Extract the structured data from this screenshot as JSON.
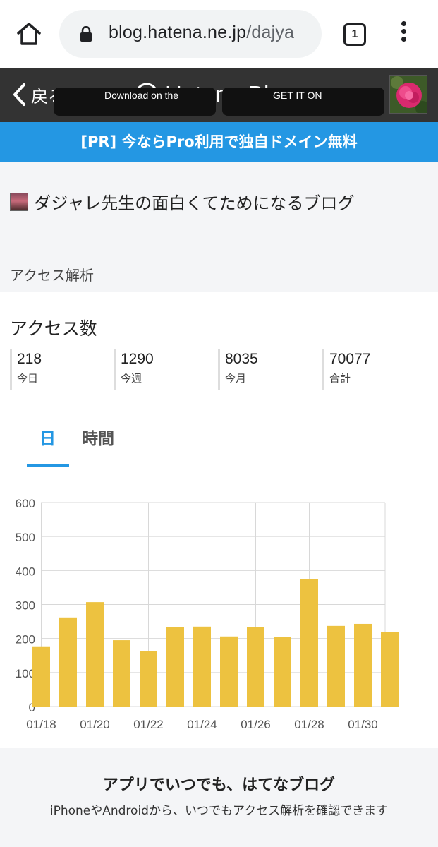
{
  "browser": {
    "url_main": "blog.hatena.ne.jp",
    "url_rest": "/dajya",
    "tab_count": "1",
    "icons": [
      "home-icon",
      "lock-icon",
      "tab-switcher-icon",
      "more-vert-icon"
    ]
  },
  "header": {
    "back_label": "戻る",
    "logo_text": "Hatena Blog",
    "icons": [
      "back-chevron-icon",
      "hatena-pen-icon",
      "flower-avatar"
    ]
  },
  "promo": {
    "text": "[PR] 今ならPro利用で独自ドメイン無料"
  },
  "blog": {
    "title": "ダジャレ先生の面白くてためになるブログ",
    "section_label": "アクセス解析"
  },
  "access": {
    "heading": "アクセス数",
    "stats": [
      {
        "value": "218",
        "label": "今日"
      },
      {
        "value": "1290",
        "label": "今週"
      },
      {
        "value": "8035",
        "label": "今月"
      },
      {
        "value": "70077",
        "label": "合計"
      }
    ]
  },
  "tabs": [
    {
      "label": "日",
      "active": true
    },
    {
      "label": "時間",
      "active": false
    }
  ],
  "chart_data": {
    "type": "bar",
    "categories": [
      "01/18",
      "01/19",
      "01/20",
      "01/21",
      "01/22",
      "01/23",
      "01/24",
      "01/25",
      "01/26",
      "01/27",
      "01/28",
      "01/29",
      "01/30",
      "01/31"
    ],
    "x_tick_labels": [
      "01/18",
      "01/20",
      "01/22",
      "01/24",
      "01/26",
      "01/28",
      "01/30"
    ],
    "values": [
      177,
      262,
      307,
      195,
      163,
      233,
      235,
      206,
      234,
      205,
      374,
      237,
      243,
      218
    ],
    "y_ticks": [
      0,
      100,
      200,
      300,
      400,
      500,
      600
    ],
    "ylim": [
      0,
      600
    ],
    "grid": true,
    "color": "#edc240"
  },
  "footer": {
    "title": "アプリでいつでも、はてなブログ",
    "text": "iPhoneやAndroidから、いつでもアクセス解析を確認できます",
    "app_store_label": "Download on the",
    "google_play_label": "GET IT ON"
  },
  "colors": {
    "accent": "#2497e3",
    "header_bg": "#333333",
    "bar": "#edc240"
  }
}
